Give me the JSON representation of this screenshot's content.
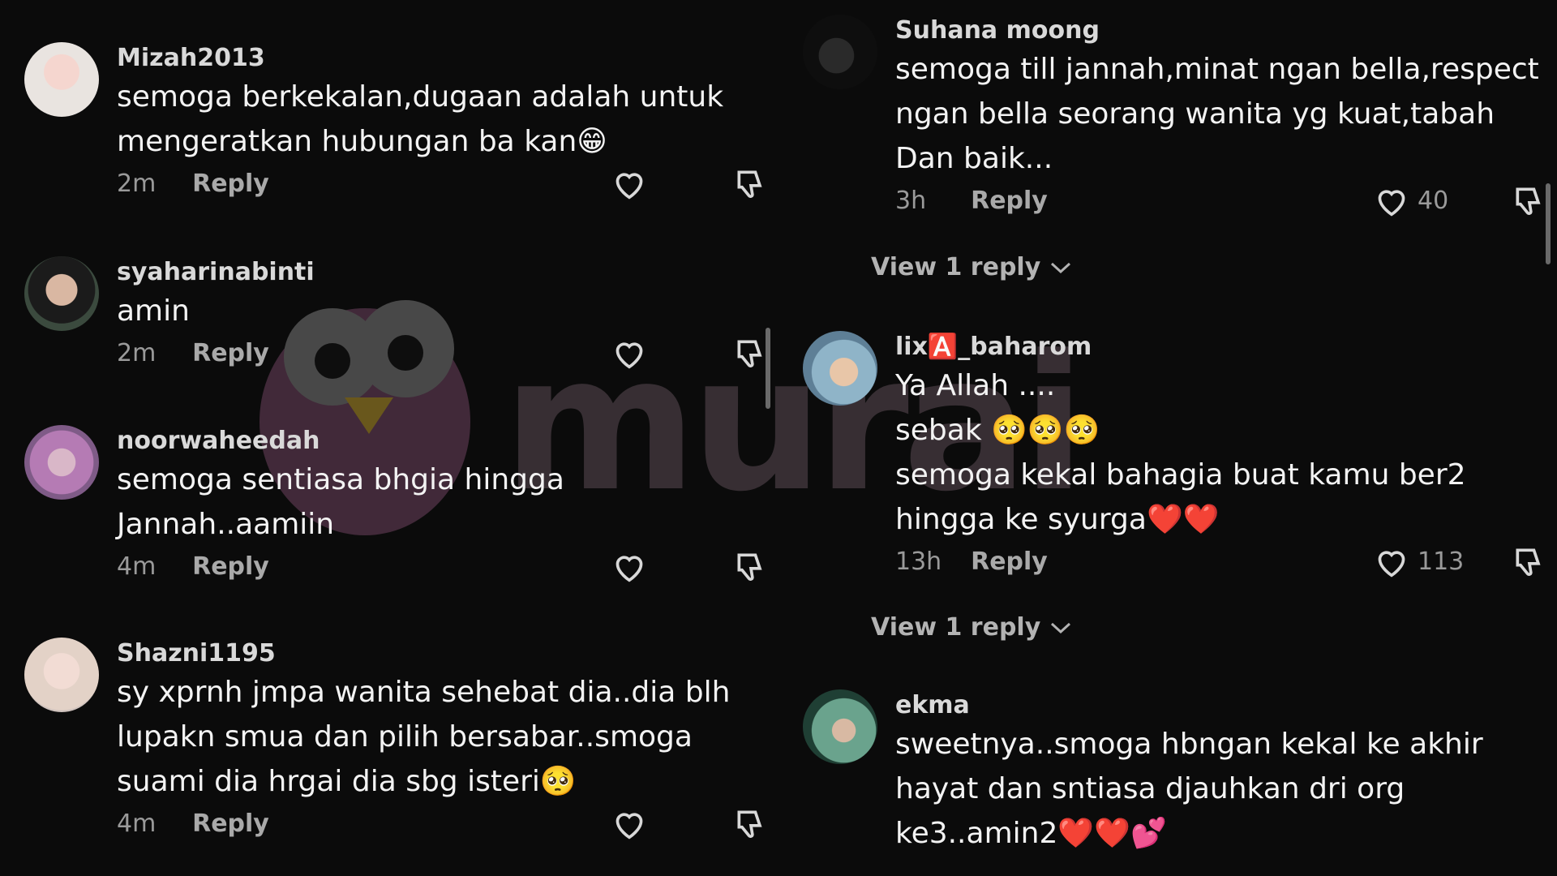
{
  "left": {
    "comments": [
      {
        "username": "Mizah2013",
        "text": "semoga berkekalan,dugaan adalah untuk\nmengeratkan hubungan ba kan😁",
        "time": "2m",
        "reply": "Reply",
        "likes": ""
      },
      {
        "username": "syaharinabinti",
        "text": "amin",
        "time": "2m",
        "reply": "Reply",
        "likes": ""
      },
      {
        "username": "noorwaheedah",
        "text": "semoga sentiasa bhgia hingga\nJannah..aamiin",
        "time": "4m",
        "reply": "Reply",
        "likes": ""
      },
      {
        "username": "Shazni1195",
        "text": "sy xprnh jmpa wanita sehebat dia..dia blh\nlupakn smua dan pilih bersabar..smoga\nsuami dia hrgai dia sbg isteri🥺",
        "time": "4m",
        "reply": "Reply",
        "likes": ""
      }
    ]
  },
  "right": {
    "comments": [
      {
        "username": "Suhana moong",
        "text": "semoga till jannah,minat ngan bella,respect\nngan bella seorang wanita yg kuat,tabah\nDan baik...",
        "time": "3h",
        "reply": "Reply",
        "likes": "40",
        "view_replies": "View 1 reply"
      },
      {
        "username": "lix🅰️_baharom",
        "text": "Ya Allah ....\nsebak 🥺🥺🥺\nsemoga kekal bahagia buat kamu ber2\nhingga ke syurga❤️❤️",
        "time": "13h",
        "reply": "Reply",
        "likes": "113",
        "view_replies": "View 1 reply"
      },
      {
        "username": "ekma",
        "text": "sweetnya..smoga hbngan kekal ke akhir\nhayat dan sntiasa djauhkan dri org\nke3..amin2❤️❤️💕",
        "time": "",
        "reply": "",
        "likes": ""
      }
    ]
  },
  "watermark": {
    "text": "murai"
  },
  "colors": {
    "background": "#0b0b0b",
    "text": "#f3f3f3",
    "muted": "#9a9a9a"
  }
}
